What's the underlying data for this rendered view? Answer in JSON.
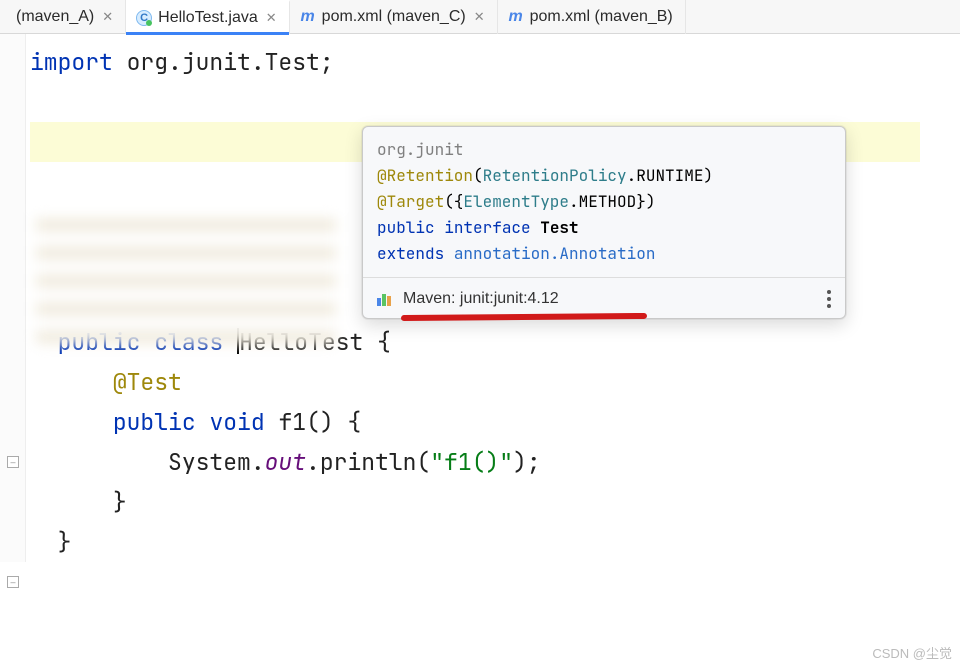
{
  "tabs": [
    {
      "label": "(maven_A)",
      "icon": "none",
      "closeable": true,
      "active": false
    },
    {
      "label": "HelloTest.java",
      "icon": "class",
      "closeable": true,
      "active": true
    },
    {
      "label": "pom.xml (maven_C)",
      "icon": "maven",
      "closeable": true,
      "active": false
    },
    {
      "label": "pom.xml (maven_B)",
      "icon": "maven",
      "closeable": false,
      "active": false
    }
  ],
  "code": {
    "line1": {
      "kw": "import",
      "rest": " org.junit.Test;"
    },
    "line_class": {
      "kw1": "public",
      "kw2": "class",
      "name": "HelloTest",
      "open": " {"
    },
    "line_ann": "@Test",
    "line_method": {
      "kw1": "public",
      "kw2": "void",
      "name": "f1",
      "rest": "() {"
    },
    "line_stmt": {
      "head": "System.",
      "out": "out",
      "mid": ".println(",
      "str": "\"f1()\"",
      "tail": ");"
    },
    "close_brace": "}"
  },
  "quickdoc": {
    "pkg": "org.junit",
    "retention_at": "@Retention",
    "retention_args_open": "(",
    "retention_type": "RetentionPolicy",
    "retention_mid": ".RUNTIME",
    "retention_close": ")",
    "target_at": "@Target",
    "target_args_open": "({",
    "target_type": "ElementType",
    "target_mid": ".METHOD",
    "target_close": "})",
    "decl_public": "public",
    "decl_interface": "interface",
    "decl_name": "Test",
    "extends_kw": "extends",
    "extends_link": "annotation.Annotation",
    "source_label": "Maven: junit:junit:4.12"
  },
  "watermark": "CSDN @尘觉"
}
